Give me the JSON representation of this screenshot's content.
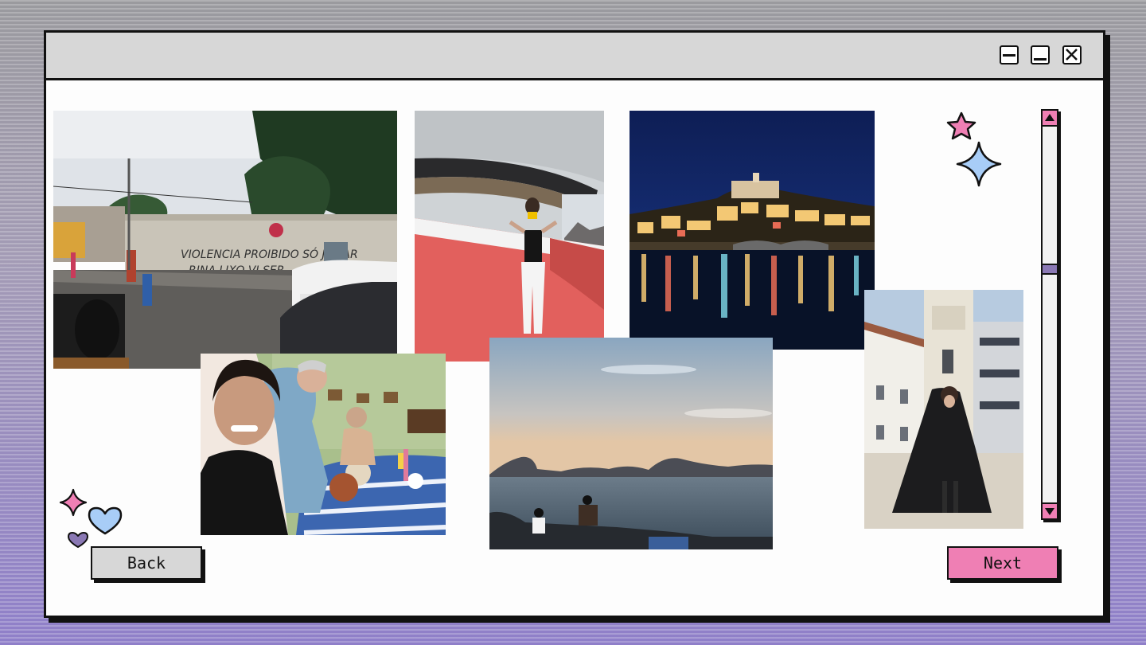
{
  "window": {
    "controls": [
      "minimize",
      "maximize",
      "close"
    ]
  },
  "photos": [
    "street-graffiti-wall",
    "woman-on-red-ramp",
    "night-city-riverside",
    "family-dinner-selfie",
    "sunset-bay-silhouettes",
    "woman-in-cape-courtyard"
  ],
  "navigation": {
    "back_label": "Back",
    "next_label": "Next"
  },
  "colors": {
    "accent_pink": "#ef7fb4",
    "accent_blue": "#a8cdf7",
    "accent_purple": "#8a78b4",
    "titlebar_gray": "#d7d7d7"
  },
  "decorations": {
    "top_right": [
      "pink-star-icon",
      "blue-sparkle-icon"
    ],
    "bottom_left": [
      "pink-sparkle-icon",
      "blue-heart-icon",
      "purple-heart-icon"
    ]
  }
}
